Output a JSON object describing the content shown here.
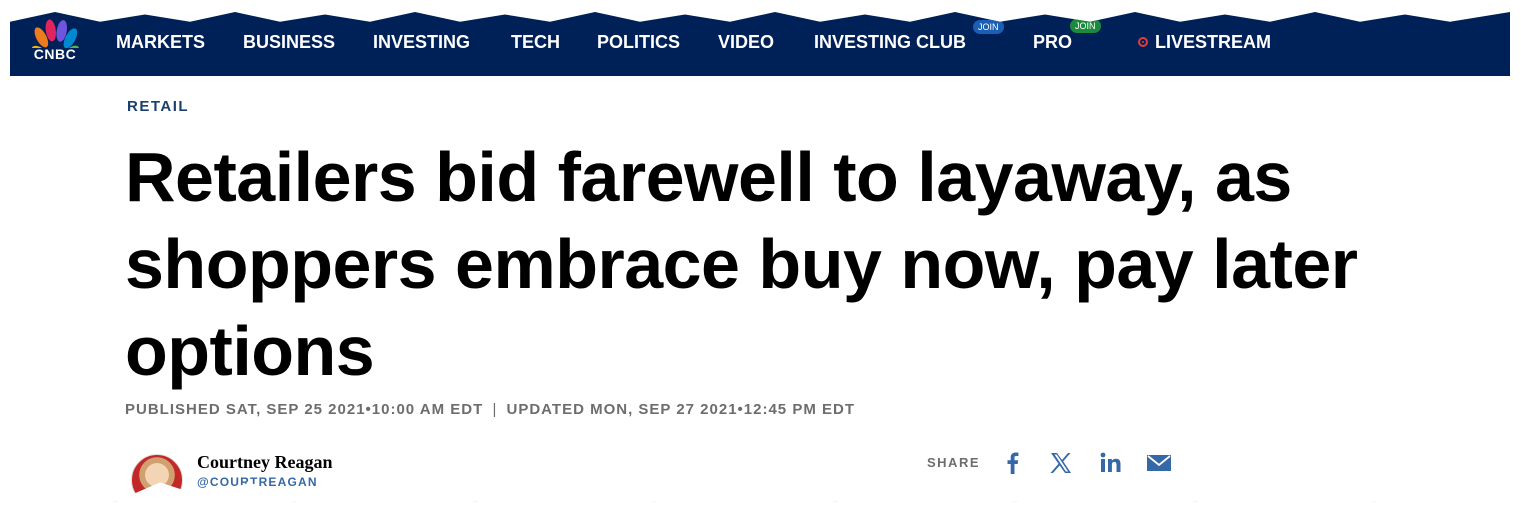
{
  "nav": {
    "logo_text": "CNBC",
    "items": [
      "MARKETS",
      "BUSINESS",
      "INVESTING",
      "TECH",
      "POLITICS",
      "VIDEO",
      "INVESTING CLUB",
      "PRO",
      "LIVESTREAM"
    ],
    "badges": {
      "investing_club": "JOIN",
      "pro": "JOIN"
    }
  },
  "article": {
    "section": "RETAIL",
    "headline": "Retailers bid farewell to layaway, as shoppers embrace buy now, pay later options",
    "published": "PUBLISHED SAT, SEP 25 2021•10:00 AM EDT",
    "separator": "|",
    "updated": "UPDATED MON, SEP 27 2021•12:45 PM EDT"
  },
  "author": {
    "name": "Courtney Reagan",
    "handle": "@COURTREAGAN"
  },
  "share": {
    "label": "SHARE",
    "icons": [
      "facebook-icon",
      "x-icon",
      "linkedin-icon",
      "email-icon"
    ]
  },
  "colors": {
    "nav_bg": "#002157",
    "share_blue": "#3568a6",
    "live_red": "#e53a3a",
    "club_badge": "#1a5fb4",
    "pro_badge": "#1c8a3c"
  }
}
